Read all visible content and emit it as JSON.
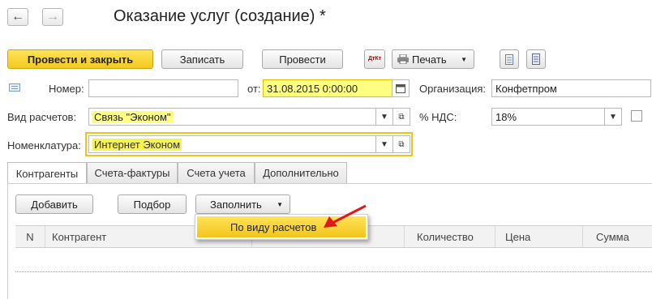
{
  "window": {
    "title": "Оказание услуг (создание) *"
  },
  "toolbar": {
    "post_close": "Провести и закрыть",
    "save": "Записать",
    "post": "Провести",
    "dtkt_icon_label": "ДтКт",
    "print": "Печать"
  },
  "form": {
    "number_label": "Номер:",
    "number_value": "",
    "date_label": "от:",
    "date_value": "31.08.2015  0:00:00",
    "org_label": "Организация:",
    "org_value": "Конфетпром",
    "calc_type_label": "Вид расчетов:",
    "calc_type_value": "Связь \"Эконом\"",
    "vat_label": "% НДС:",
    "vat_value": "18%",
    "nomenclature_label": "Номенклатура:",
    "nomenclature_value": "Интернет Эконом"
  },
  "tabs": [
    {
      "label": "Контрагенты"
    },
    {
      "label": "Счета-фактуры"
    },
    {
      "label": "Счета учета"
    },
    {
      "label": "Дополнительно"
    }
  ],
  "table_toolbar": {
    "add": "Добавить",
    "pick": "Подбор",
    "fill": "Заполнить"
  },
  "dropdown": {
    "item": "По виду расчетов"
  },
  "table": {
    "columns": [
      "N",
      "Контрагент",
      "Количество",
      "Цена",
      "Сумма"
    ]
  },
  "colors": {
    "accent_yellow": "#f3c91c",
    "highlight": "#ffff80",
    "arrow": "#e01818"
  }
}
